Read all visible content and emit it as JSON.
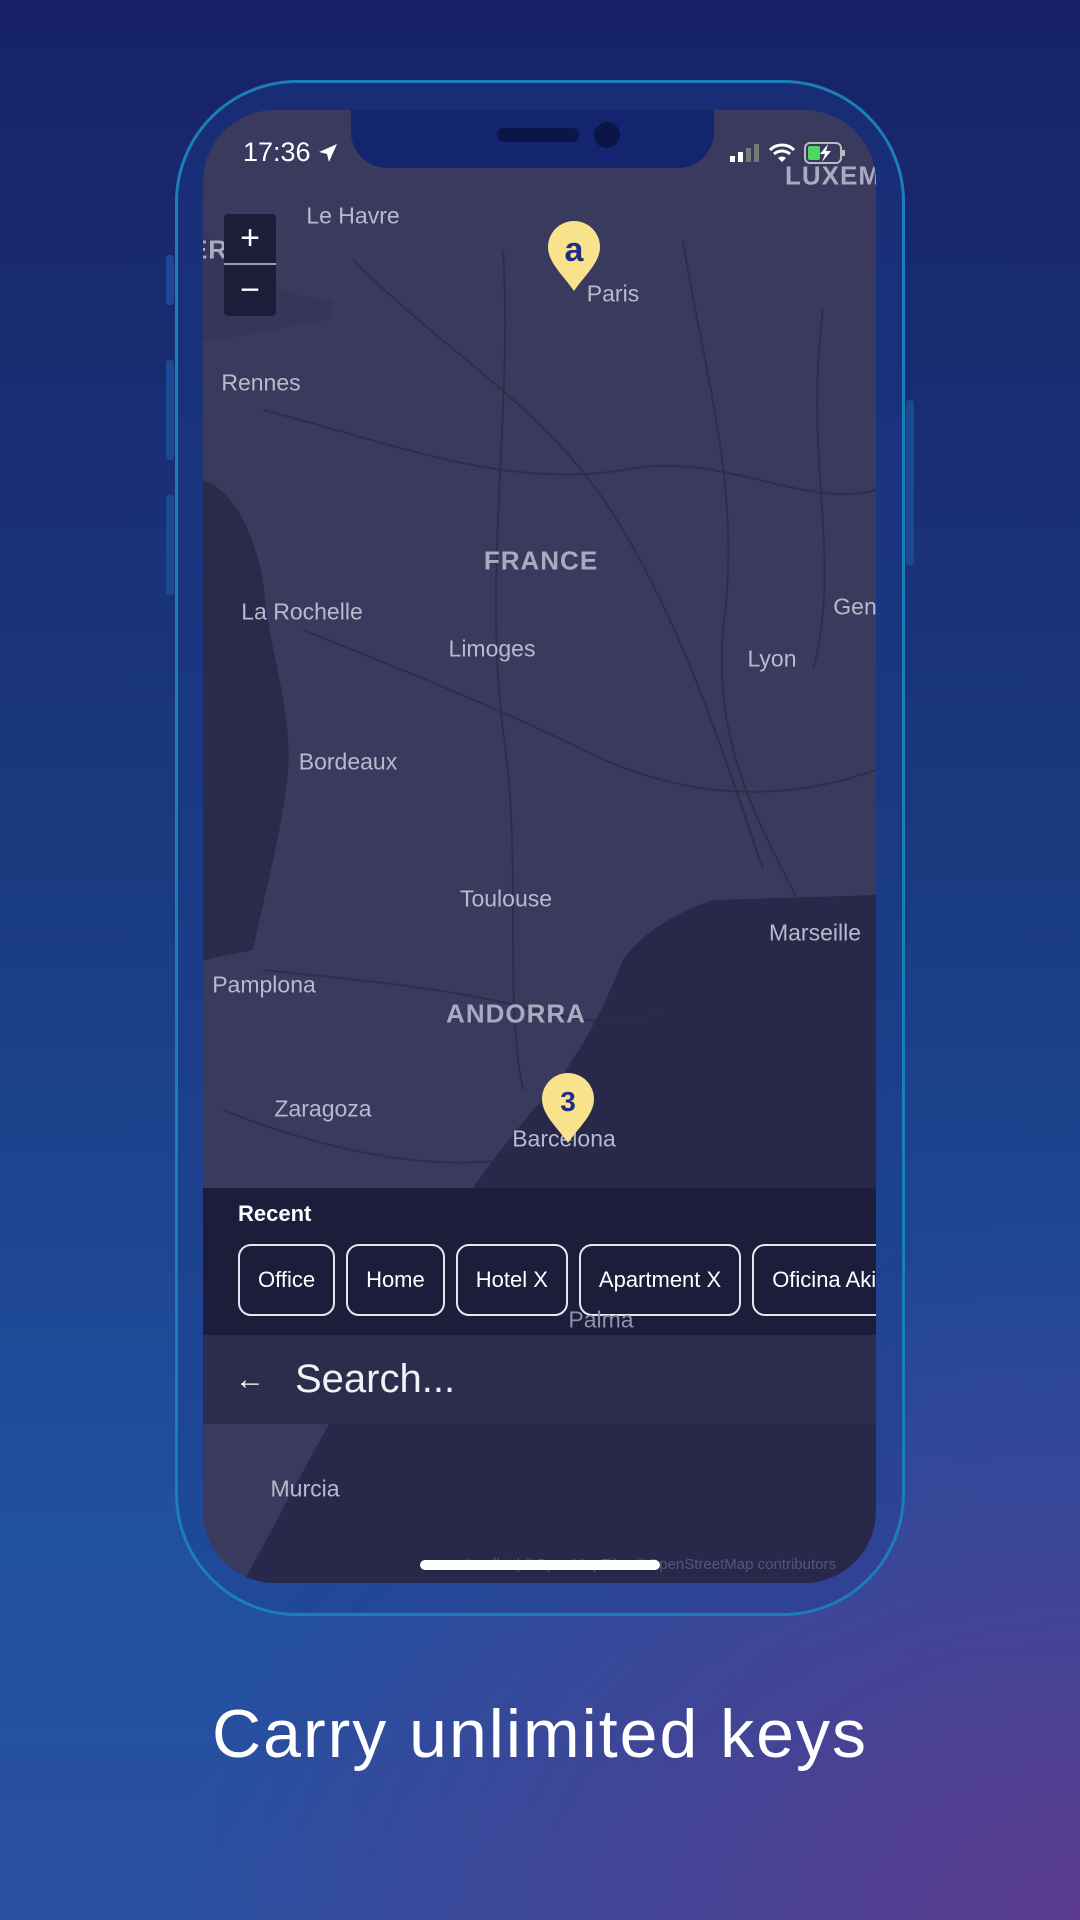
{
  "status_bar": {
    "time": "17:36"
  },
  "map": {
    "zoom_in": "+",
    "zoom_out": "−",
    "labels": [
      "Le Havre",
      "Paris",
      "Rennes",
      "FRANCE",
      "La Rochelle",
      "Limoges",
      "Lyon",
      "Gen",
      "Bordeaux",
      "Toulouse",
      "Marseille",
      "Pamplona",
      "ANDORRA",
      "Zaragoza",
      "Barcelona",
      "Murcia",
      "LUXEM",
      "ER",
      "Palma"
    ],
    "markers": [
      {
        "glyph": "a",
        "icon": "akiles-logo-pin"
      },
      {
        "glyph": "3",
        "icon": "cluster-pin"
      }
    ],
    "attribution": "Leaflet | ©OpenMapTiles ©OpenStreetMap contributors",
    "pin_color": "#f9e28c"
  },
  "recent": {
    "title": "Recent",
    "chips": [
      "Office",
      "Home",
      "Hotel X",
      "Apartment X",
      "Oficina Akiles E"
    ]
  },
  "search": {
    "placeholder": "Search..."
  },
  "caption": "Carry unlimited keys"
}
